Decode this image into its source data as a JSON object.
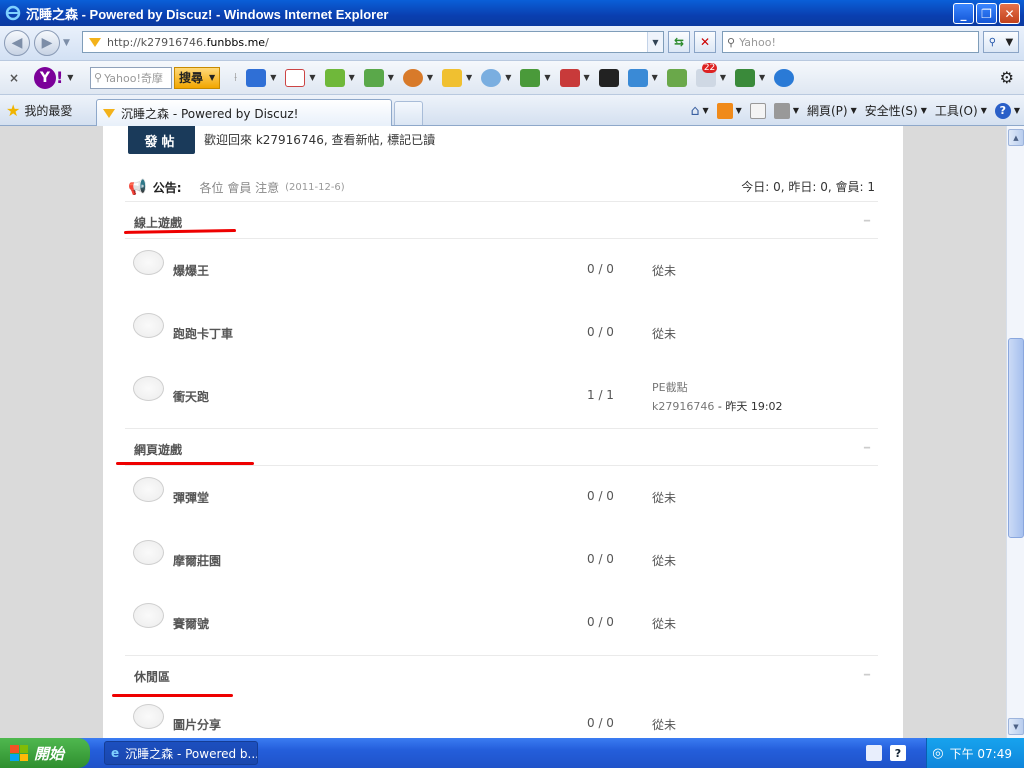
{
  "window": {
    "title": "沉睡之森 - Powered by Discuz! - Windows Internet Explorer",
    "min": "_",
    "max": "❐",
    "close": "✕"
  },
  "address": {
    "url_prefix": "http://k27916746.",
    "url_domain": "funbbs.me",
    "url_suffix": "/",
    "search_placeholder": "Yahoo!"
  },
  "yahoo_toolbar": {
    "close": "×",
    "logo_text": "!",
    "search_placeholder": "Yahoo!奇摩",
    "search_button": "搜尋",
    "badge_count": "22"
  },
  "favbar": {
    "favorites_label": "我的最愛",
    "tab_title": "沉睡之森 - Powered by Discuz!",
    "page_menu": "網頁(P)",
    "safety_menu": "安全性(S)",
    "tools_menu": "工具(O)",
    "help": "?"
  },
  "page": {
    "post_button": "發帖",
    "welcome": "歡迎回來 k27916746, 查看新帖, 標記已讀",
    "announce_label": "公告:",
    "announce_text": "各位 會員 注意",
    "announce_date": "(2011-12-6)",
    "stats": "今日: 0, 昨日: 0, 會員: 1",
    "categories": [
      {
        "name": "線上遊戲",
        "forums": [
          {
            "name": "爆爆王",
            "count": "0 / 0",
            "last": "從未"
          },
          {
            "name": "跑跑卡丁車",
            "count": "0 / 0",
            "last": "從未"
          },
          {
            "name": "衝天跑",
            "count": "1 / 1",
            "last_title": "PE截點",
            "last_user": "k27916746",
            "last_time": "- 昨天 19:02"
          }
        ]
      },
      {
        "name": "網頁遊戲",
        "forums": [
          {
            "name": "彈彈堂",
            "count": "0 / 0",
            "last": "從未"
          },
          {
            "name": "摩爾莊園",
            "count": "0 / 0",
            "last": "從未"
          },
          {
            "name": "賽爾號",
            "count": "0 / 0",
            "last": "從未"
          }
        ]
      },
      {
        "name": "休閒區",
        "forums": [
          {
            "name": "圖片分享",
            "count": "0 / 0",
            "last": "從未"
          }
        ]
      }
    ]
  },
  "taskbar": {
    "start": "開始",
    "task_title": "沉睡之森 - Powered b...",
    "clock": "下午 07:49",
    "help": "?"
  },
  "colors": {
    "annotation_red": "#e00000",
    "post_button_bg": "#1a3a5a",
    "titlebar_blue": "#0a4fc8"
  }
}
